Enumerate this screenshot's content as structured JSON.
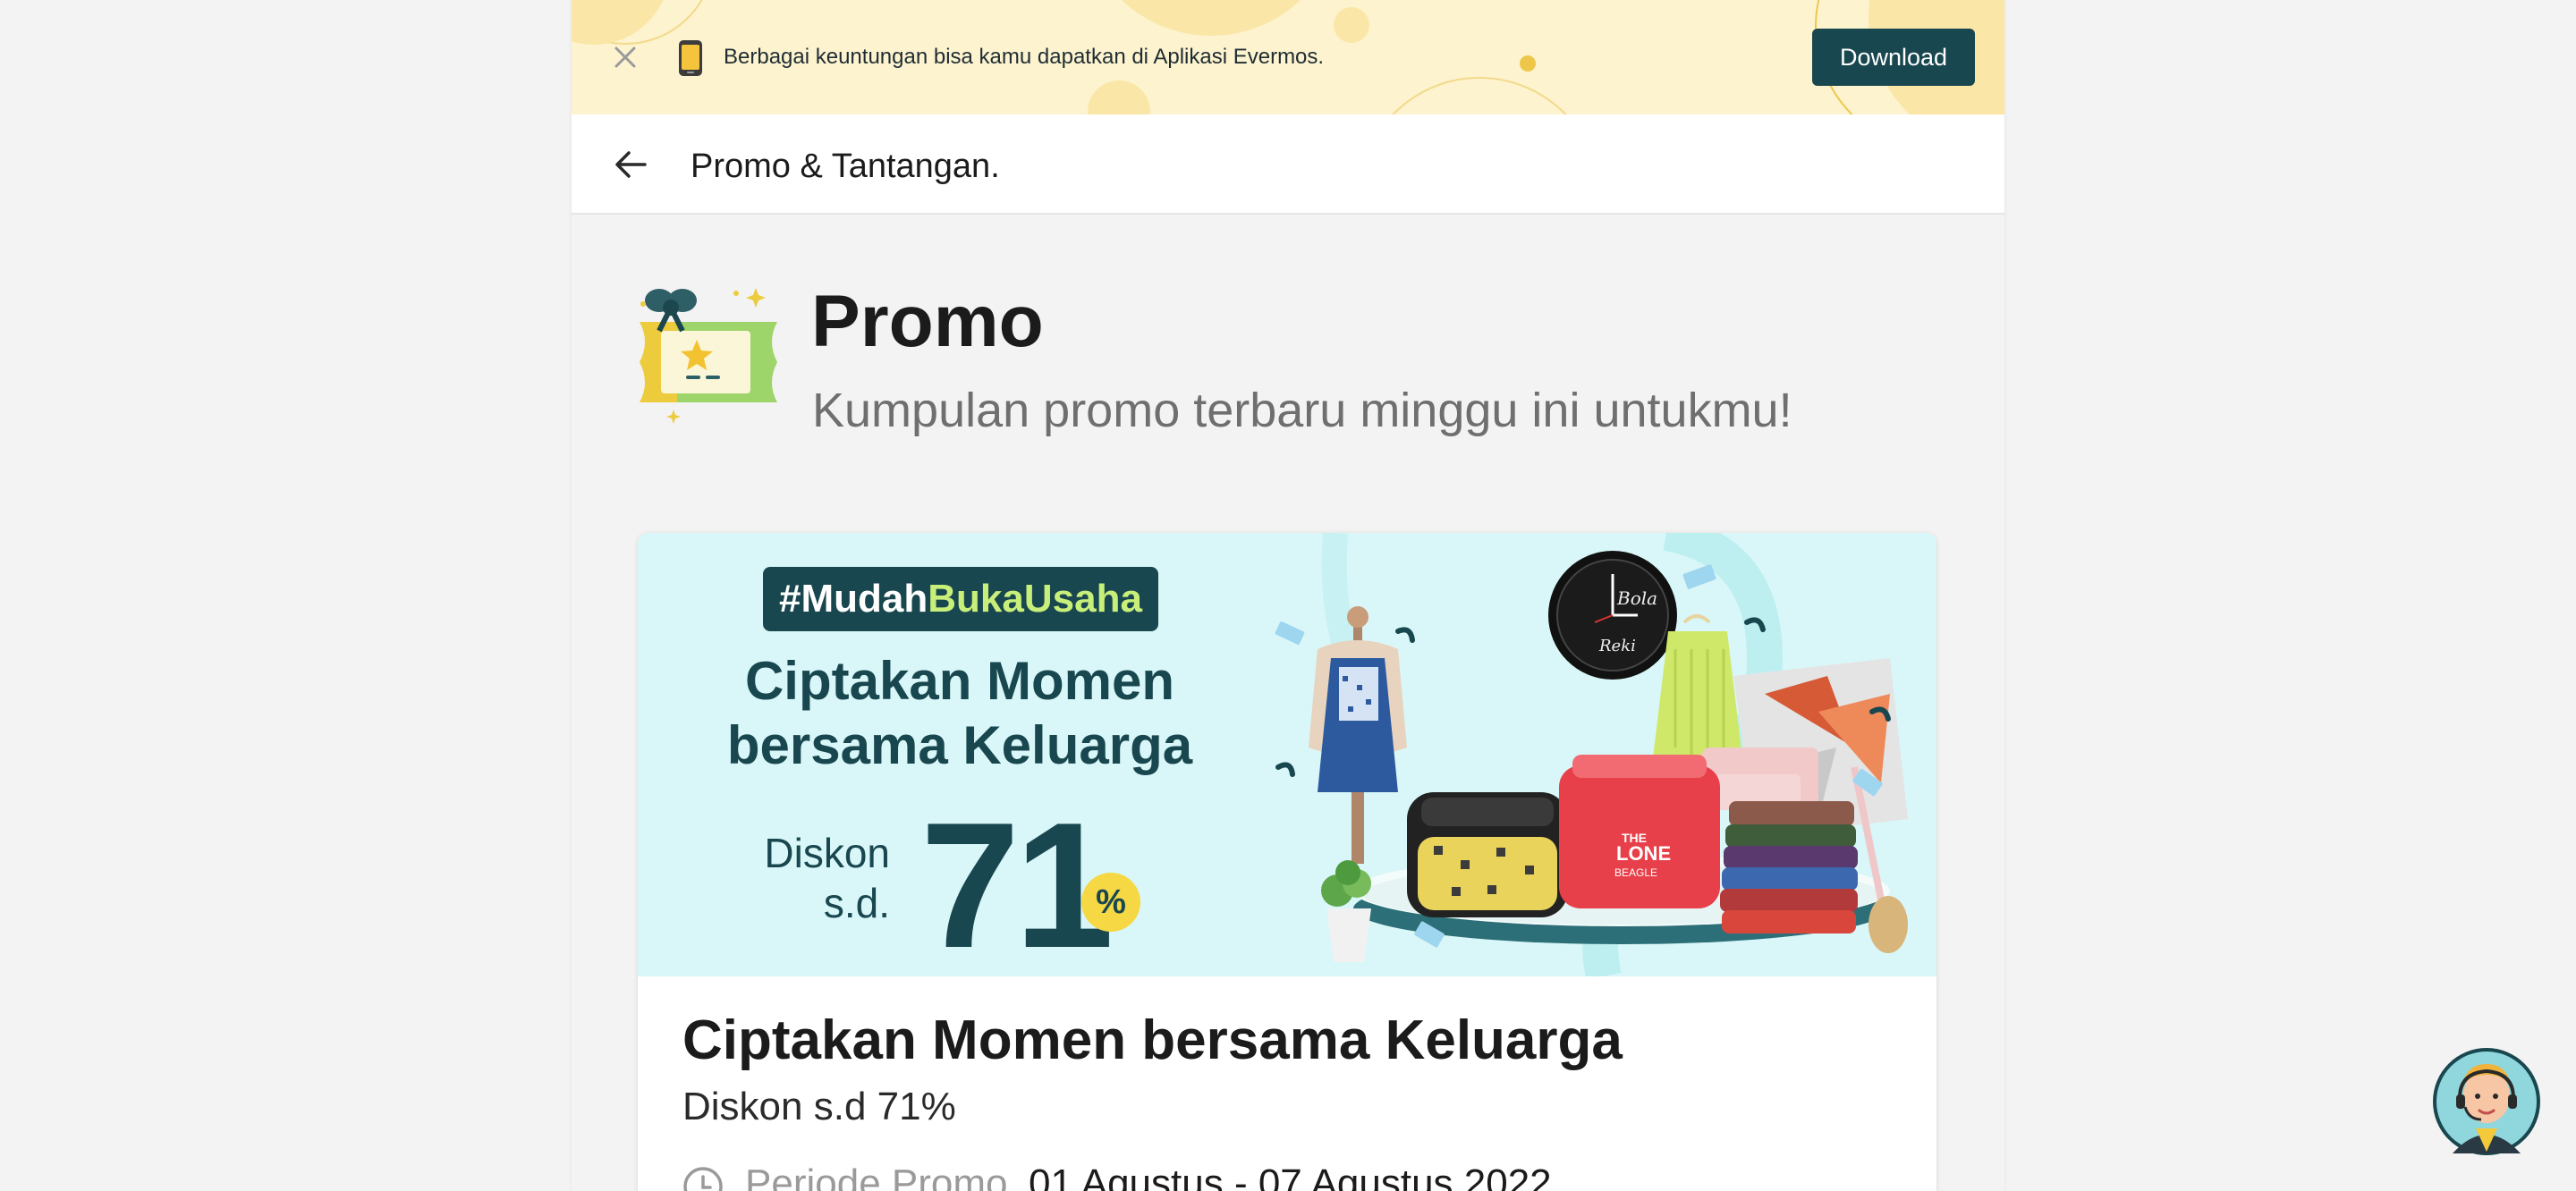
{
  "download_banner": {
    "message": "Berbagai keuntungan bisa kamu dapatkan di Aplikasi Evermos.",
    "button_label": "Download",
    "close_icon": "close-icon",
    "phone_icon": "phone-icon"
  },
  "header": {
    "back_icon": "arrow-left-icon",
    "title": "Promo & Tantangan."
  },
  "promo_section": {
    "icon": "gift-voucher-icon",
    "title": "Promo",
    "subtitle": "Kumpulan promo terbaru minggu ini untukmu!"
  },
  "promo_card": {
    "banner": {
      "hashtag_prefix": "#Mudah",
      "hashtag_highlight": "BukaUsaha",
      "headline_line1": "Ciptakan Momen",
      "headline_line2": "bersama Keluarga",
      "discount_line1": "Diskon",
      "discount_line2": "s.d.",
      "discount_number": "71",
      "discount_percent": "%",
      "clock_text_top": "Bola",
      "clock_text_bottom": "Reki",
      "case_text_top": "THE",
      "case_text_mid": "LONE",
      "case_text_bottom": "BEAGLE"
    },
    "title": "Ciptakan Momen bersama Keluarga",
    "subtitle": "Diskon s.d 71%",
    "period_label": "Periode Promo",
    "period_value": "01 Agustus - 07 Agustus 2022",
    "period_icon": "clock-icon"
  },
  "chat": {
    "icon": "customer-service-avatar-icon"
  },
  "colors": {
    "brand_dark_teal": "#19474f",
    "banner_bg": "#fdf3cf",
    "promo_banner_bg": "#d9f7f8",
    "accent_yellow": "#f6d845",
    "accent_lime": "#c8ef7a"
  }
}
